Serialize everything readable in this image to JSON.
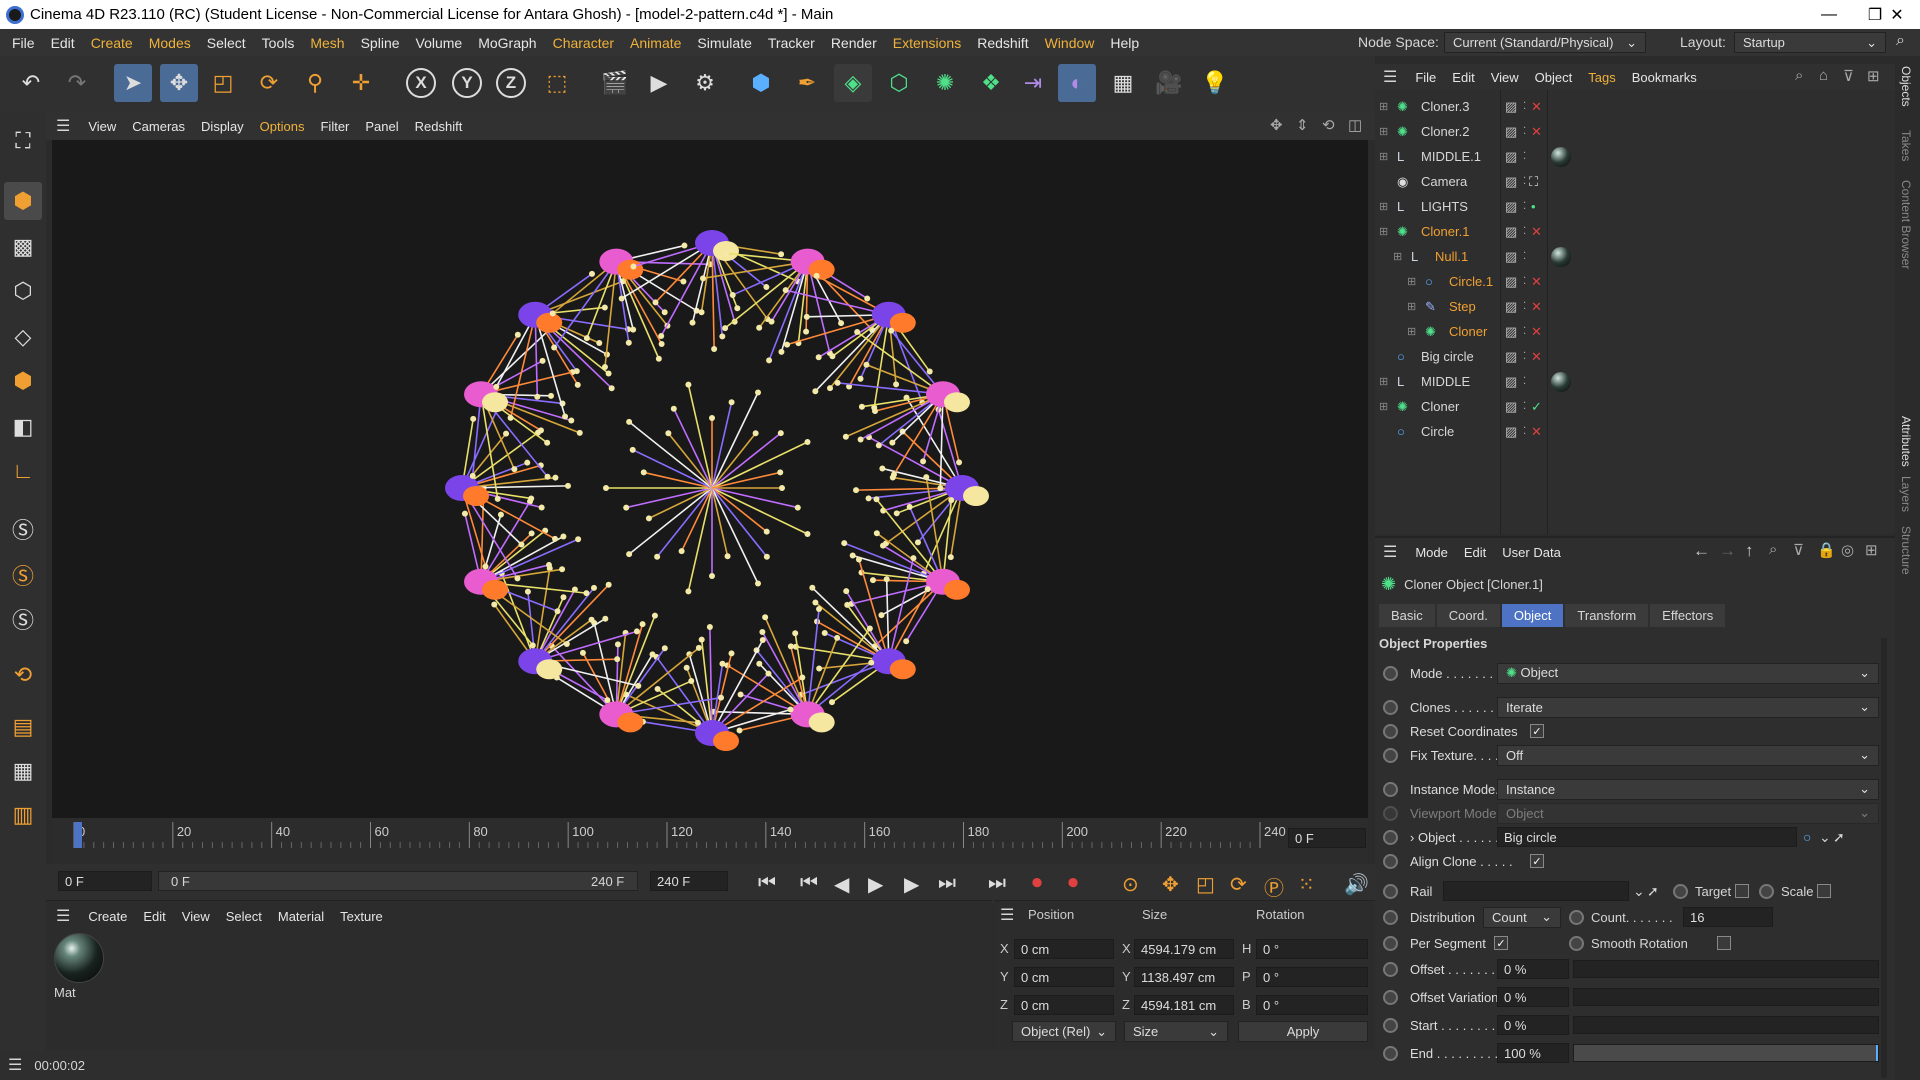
{
  "titlebar": {
    "title": "Cinema 4D R23.110 (RC) (Student License - Non-Commercial License for Antara Ghosh) - [model-2-pattern.c4d *] - Main",
    "minimize": "—",
    "restore": "❐",
    "close": "✕"
  },
  "menubar": {
    "items": [
      "File",
      "Edit",
      "Create",
      "Modes",
      "Select",
      "Tools",
      "Mesh",
      "Spline",
      "Volume",
      "MoGraph",
      "Character",
      "Animate",
      "Simulate",
      "Tracker",
      "Render",
      "Extensions",
      "Redshift",
      "Window",
      "Help"
    ],
    "highlighted": [
      "Create",
      "Modes",
      "Mesh",
      "Character",
      "Animate",
      "Extensions",
      "Window"
    ],
    "node_space_label": "Node Space:",
    "node_space_value": "Current (Standard/Physical)",
    "layout_label": "Layout:",
    "layout_value": "Startup"
  },
  "viewport": {
    "menu": [
      "View",
      "Cameras",
      "Display",
      "Options",
      "Filter",
      "Panel",
      "Redshift"
    ],
    "highlighted": [
      "Options"
    ]
  },
  "timeline": {
    "ticks": [
      "0",
      "20",
      "40",
      "60",
      "80",
      "100",
      "120",
      "140",
      "160",
      "180",
      "200",
      "220",
      "240"
    ],
    "current_frame": "0 F"
  },
  "transport": {
    "start_field": "0 F",
    "range_start": "0 F",
    "range_end": "240 F",
    "end_field": "240 F"
  },
  "materials": {
    "menu": [
      "Create",
      "Edit",
      "View",
      "Select",
      "Material",
      "Texture"
    ],
    "mat_name": "Mat"
  },
  "coords": {
    "headers": [
      "Position",
      "Size",
      "Rotation"
    ],
    "rows": [
      {
        "axis": "X",
        "pos": "0 cm",
        "saxis": "X",
        "size": "4594.179 cm",
        "raxis": "H",
        "rot": "0 °"
      },
      {
        "axis": "Y",
        "pos": "0 cm",
        "saxis": "Y",
        "size": "1138.497 cm",
        "raxis": "P",
        "rot": "0 °"
      },
      {
        "axis": "Z",
        "pos": "0 cm",
        "saxis": "Z",
        "size": "4594.181 cm",
        "raxis": "B",
        "rot": "0 °"
      }
    ],
    "mode": "Object (Rel)",
    "size_mode": "Size",
    "apply": "Apply"
  },
  "objmgr": {
    "menu": [
      "File",
      "Edit",
      "View",
      "Object",
      "Tags",
      "Bookmarks"
    ],
    "objects": [
      {
        "name": "Cloner.3",
        "color": "#d6d6d6",
        "indent": 0,
        "icon": "✺",
        "status": "x"
      },
      {
        "name": "Cloner.2",
        "color": "#d6d6d6",
        "indent": 0,
        "icon": "✺",
        "status": "x"
      },
      {
        "name": "MIDDLE.1",
        "color": "#d6d6d6",
        "indent": 0,
        "icon": "L",
        "status": "mat"
      },
      {
        "name": "Camera",
        "color": "#d6d6d6",
        "indent": 0,
        "icon": "◉",
        "status": "cam"
      },
      {
        "name": "LIGHTS",
        "color": "#d6d6d6",
        "indent": 0,
        "icon": "L",
        "status": "dot"
      },
      {
        "name": "Cloner.1",
        "color": "#f0a032",
        "indent": 0,
        "icon": "✺",
        "status": "x"
      },
      {
        "name": "Null.1",
        "color": "#f0a032",
        "indent": 1,
        "icon": "L",
        "status": "mat"
      },
      {
        "name": "Circle.1",
        "color": "#f0a032",
        "indent": 2,
        "icon": "○",
        "status": "x"
      },
      {
        "name": "Step",
        "color": "#f0a032",
        "indent": 2,
        "icon": "✎",
        "status": "x"
      },
      {
        "name": "Cloner",
        "color": "#f0a032",
        "indent": 2,
        "icon": "✺",
        "status": "x"
      },
      {
        "name": "Big circle",
        "color": "#d6d6d6",
        "indent": 0,
        "icon": "○",
        "status": "x"
      },
      {
        "name": "MIDDLE",
        "color": "#d6d6d6",
        "indent": 0,
        "icon": "L",
        "status": "mat"
      },
      {
        "name": "Cloner",
        "color": "#d6d6d6",
        "indent": 0,
        "icon": "✺",
        "status": "check"
      },
      {
        "name": "Circle",
        "color": "#d6d6d6",
        "indent": 0,
        "icon": "○",
        "status": "x"
      }
    ]
  },
  "attr": {
    "menu": [
      "Mode",
      "Edit",
      "User Data"
    ],
    "header": "Cloner Object [Cloner.1]",
    "tabs": [
      "Basic",
      "Coord.",
      "Object",
      "Transform",
      "Effectors"
    ],
    "active_tab": "Object",
    "section": "Object Properties",
    "mode_label": "Mode . . . . . . . . .",
    "mode_value": "Object",
    "clones_label": "Clones . . . . . . . .",
    "clones_value": "Iterate",
    "reset_label": "Reset Coordinates",
    "fix_label": "Fix Texture. . . . . .",
    "fix_value": "Off",
    "instance_label": "Instance Mode. .",
    "instance_value": "Instance",
    "viewport_label": "Viewport Mode .",
    "viewport_value": "Object",
    "object_label": "Object . . . . . . .",
    "object_value": "Big circle",
    "align_label": "Align Clone . . . . .",
    "rail_label": "Rail",
    "target_label": "Target",
    "scale_label": "Scale",
    "dist_label": "Distribution",
    "dist_value": "Count",
    "count_label": "Count. . . . . . .",
    "count_value": "16",
    "perseg_label": "Per Segment",
    "smooth_label": "Smooth Rotation",
    "offset_label": "Offset . . . . . . . .",
    "offset_value": "0 %",
    "offvar_label": "Offset Variation",
    "offvar_value": "0 %",
    "start_label": "Start . . . . . . . .",
    "start_value": "0 %",
    "end_label": "End . . . . . . . . .",
    "end_value": "100 %",
    "end_fraction": 1.0
  },
  "rightstrip": [
    "Objects",
    "Takes",
    "Content Browser",
    "Attributes",
    "Layers",
    "Structure"
  ],
  "status": {
    "time": "00:00:02"
  }
}
